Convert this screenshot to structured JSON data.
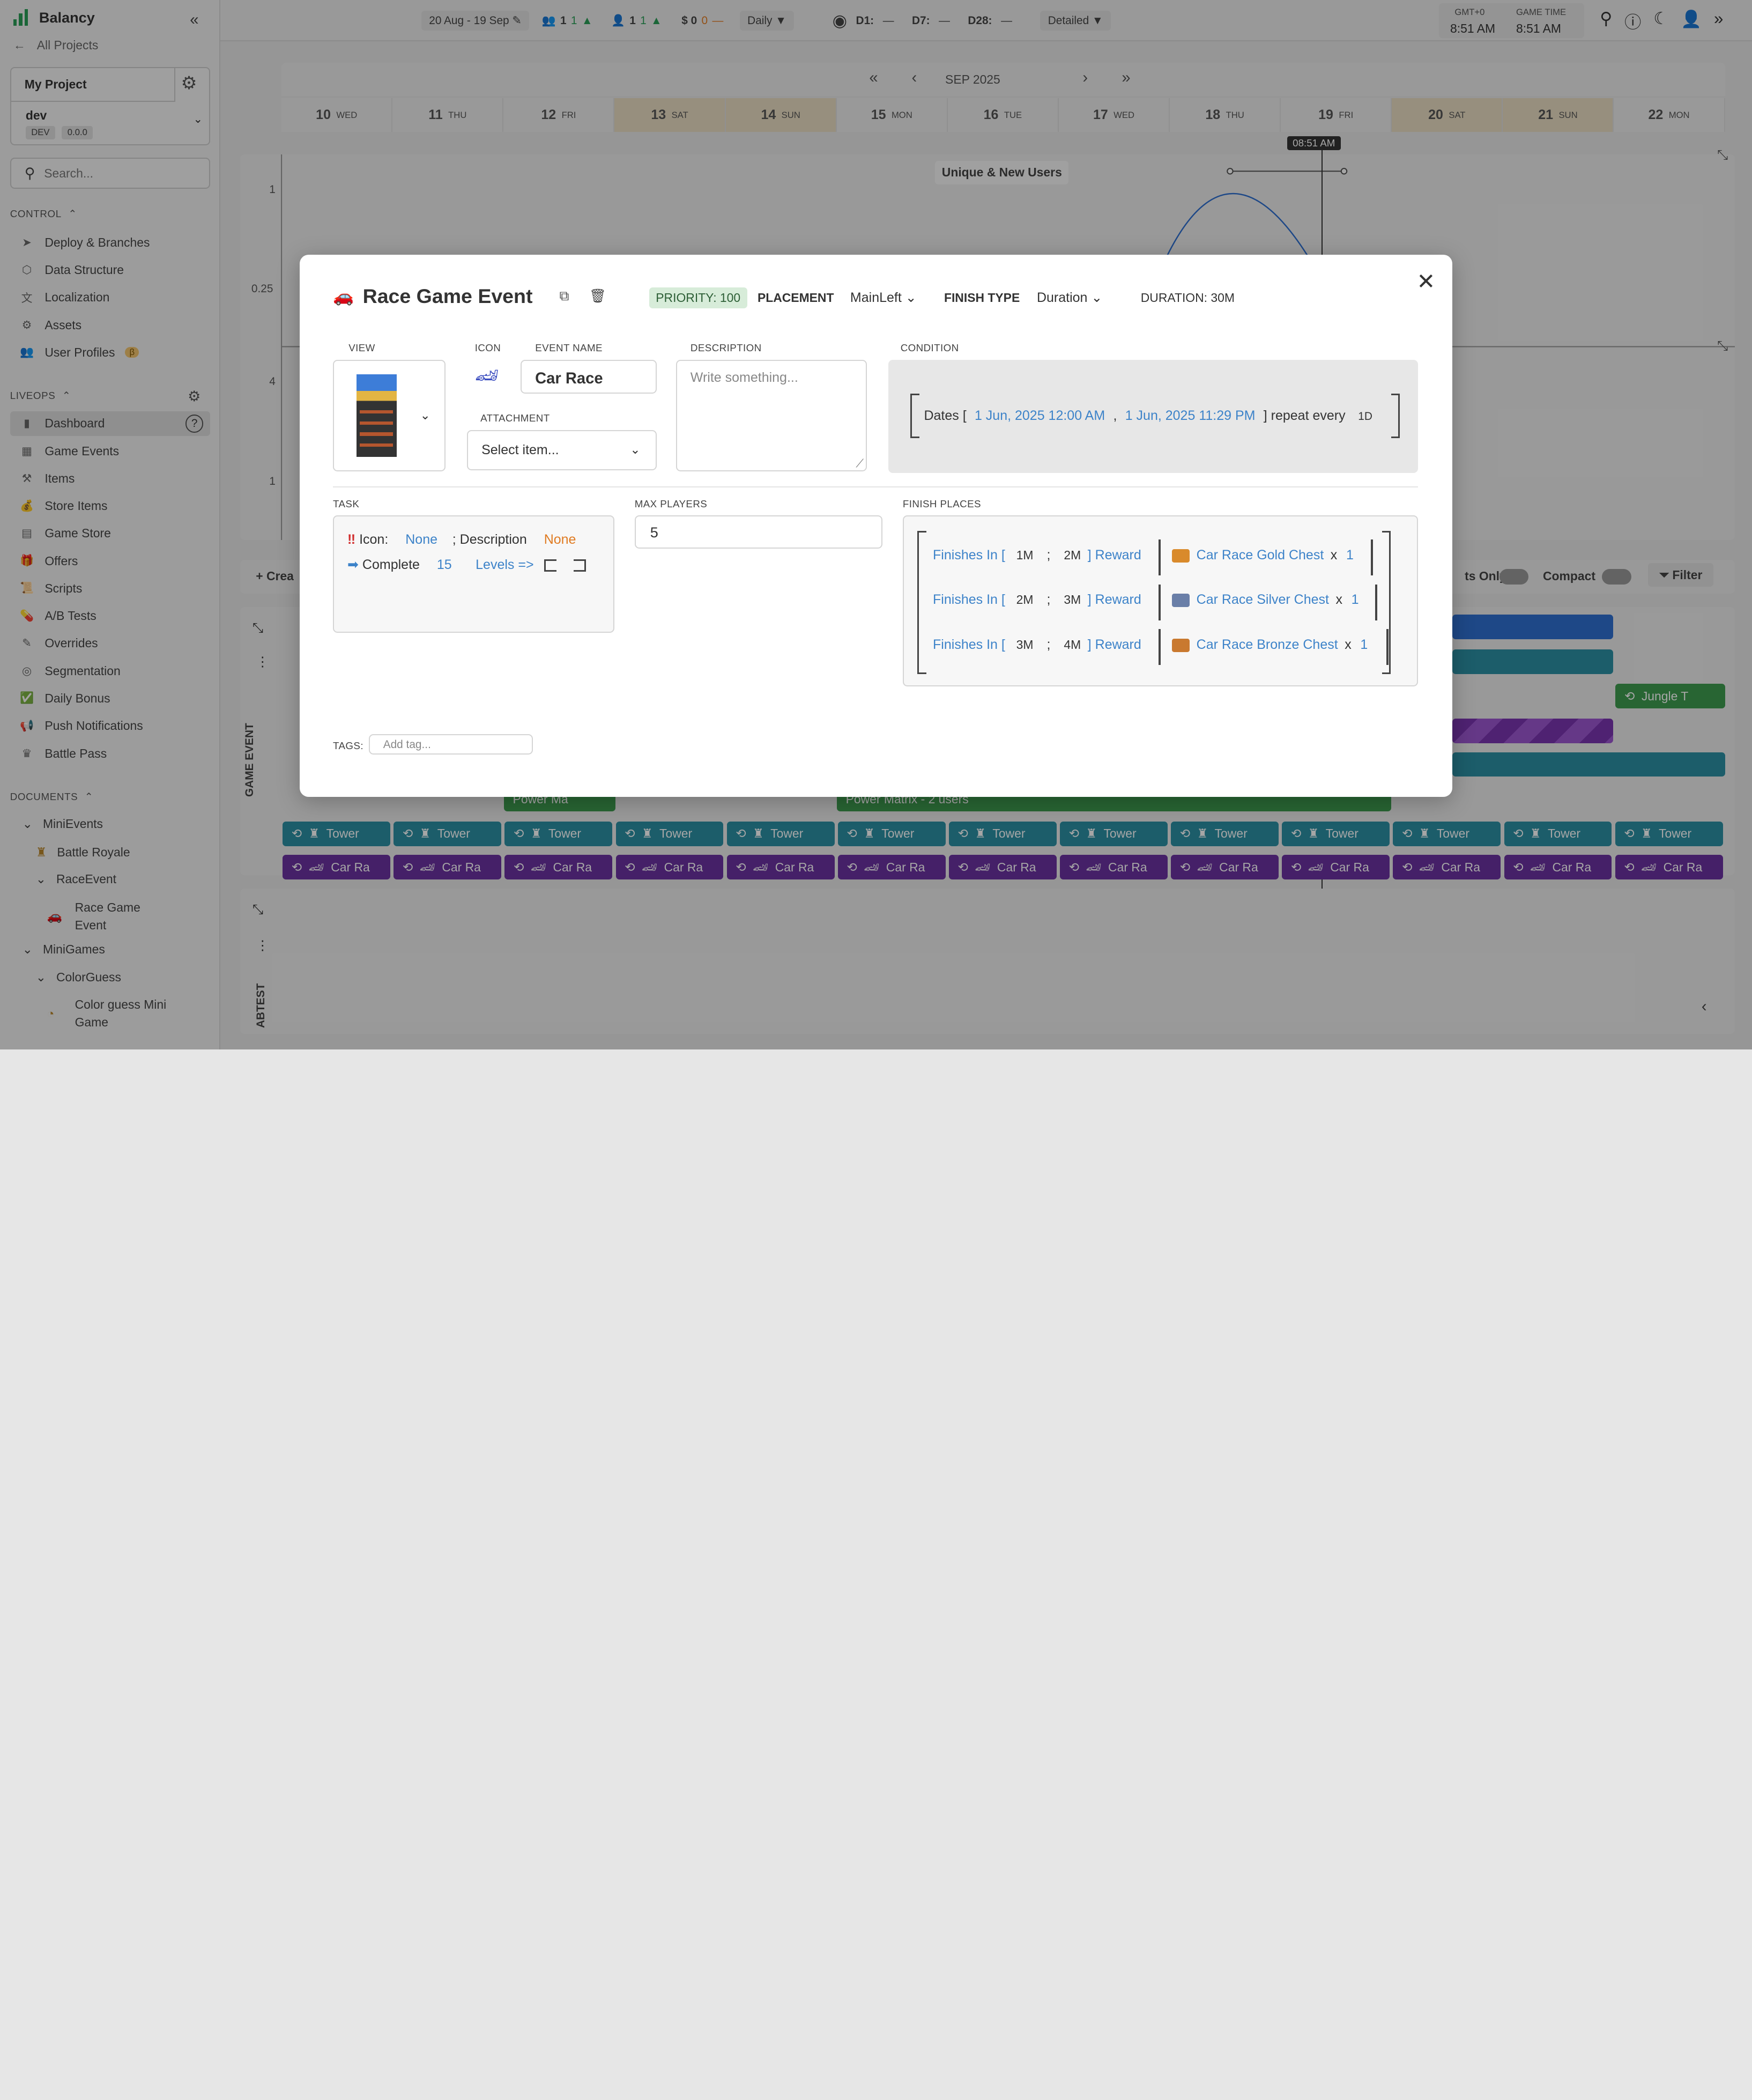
{
  "app": {
    "name": "Balancy",
    "all_projects": "All Projects"
  },
  "project": {
    "name": "My Project",
    "branch": "dev",
    "env": "DEV",
    "version": "0.0.0"
  },
  "search": {
    "placeholder": "Search..."
  },
  "sections": {
    "control": "CONTROL",
    "liveops": "LIVEOPS",
    "documents": "DOCUMENTS"
  },
  "control_items": [
    "Deploy & Branches",
    "Data Structure",
    "Localization",
    "Assets",
    "User Profiles"
  ],
  "user_profiles_badge": "β",
  "liveops_items": [
    "Dashboard",
    "Game Events",
    "Items",
    "Store Items",
    "Game Store",
    "Offers",
    "Scripts",
    "A/B Tests",
    "Overrides",
    "Segmentation",
    "Daily Bonus",
    "Push Notifications",
    "Battle Pass"
  ],
  "documents": {
    "minievents": "MiniEvents",
    "battle_royale": "Battle Royale",
    "raceevent": "RaceEvent",
    "race_game_event_1": "Race Game",
    "race_game_event_2": "Event",
    "minigames": "MiniGames",
    "colorguess": "ColorGuess",
    "color_guess_1": "Color guess Mini",
    "color_guess_2": "Game"
  },
  "topbar": {
    "date_range": "20 Aug - 19 Sep",
    "users_a": "1",
    "users_a_delta": "1",
    "users_b": "1",
    "users_b_delta": "1",
    "revenue": "$ 0",
    "revenue_delta": "0",
    "revenue_dash": "—",
    "period": "Daily",
    "d1": "D1:",
    "d1_val": "—",
    "d7": "D7:",
    "d7_val": "—",
    "d28": "D28:",
    "d28_val": "—",
    "mode": "Detailed",
    "tz_label": "GMT+0",
    "tz_time": "8:51 AM",
    "game_time_label": "GAME TIME",
    "game_time": "8:51 AM"
  },
  "calendar": {
    "month": "SEP 2025",
    "days": [
      {
        "n": "10",
        "d": "WED"
      },
      {
        "n": "11",
        "d": "THU"
      },
      {
        "n": "12",
        "d": "FRI"
      },
      {
        "n": "13",
        "d": "SAT"
      },
      {
        "n": "14",
        "d": "SUN"
      },
      {
        "n": "15",
        "d": "MON"
      },
      {
        "n": "16",
        "d": "TUE"
      },
      {
        "n": "17",
        "d": "WED"
      },
      {
        "n": "18",
        "d": "THU"
      },
      {
        "n": "19",
        "d": "FRI"
      },
      {
        "n": "20",
        "d": "SAT"
      },
      {
        "n": "21",
        "d": "SUN"
      },
      {
        "n": "22",
        "d": "MON"
      }
    ],
    "now_label": "08:51 AM",
    "chart_title": "Unique & New Users",
    "y_ticks": [
      "1",
      "0.25",
      "4",
      "1"
    ]
  },
  "timeline": {
    "create": "+ Crea",
    "events_only": "ts Only",
    "compact": "Compact",
    "filter": "Filter",
    "lane_game_event": "GAME EVENT",
    "lane_abtest": "ABTEST",
    "jungle": "Jungle T",
    "power_ma": "Power Ma",
    "power_matrix": "Power Matrix - 2 users",
    "tower": "Tower",
    "car": "Car Ra"
  },
  "modal": {
    "title": "Race Game Event",
    "priority": "PRIORITY: 100",
    "placement_label": "PLACEMENT",
    "placement_value": "MainLeft",
    "finish_type_label": "FINISH TYPE",
    "finish_type_value": "Duration",
    "duration": "DURATION: 30M",
    "view_label": "VIEW",
    "icon_label": "ICON",
    "event_name_label": "EVENT NAME",
    "event_name": "Car Race",
    "attachment_label": "ATTACHMENT",
    "attachment_value": "Select item...",
    "description_label": "DESCRIPTION",
    "description_placeholder": "Write something...",
    "condition_label": "CONDITION",
    "condition": {
      "dates": "Dates [",
      "from": "1 Jun, 2025 12:00 AM",
      "sep": ",",
      "to": "1 Jun, 2025 11:29 PM",
      "repeat": "] repeat every",
      "interval": "1D"
    },
    "task_label": "TASK",
    "task": {
      "icon_label": "Icon:",
      "icon_value": "None",
      "desc_label": "; Description",
      "desc_value": "None",
      "complete": "Complete",
      "count": "15",
      "levels": "Levels =>"
    },
    "max_players_label": "MAX PLAYERS",
    "max_players": "5",
    "finish_places_label": "FINISH PLACES",
    "finish_places": [
      {
        "from": "1M",
        "to": "2M",
        "reward": "Car Race Gold Chest",
        "count": "1",
        "color": "#d98a2b"
      },
      {
        "from": "2M",
        "to": "3M",
        "reward": "Car Race Silver Chest",
        "count": "1",
        "color": "#6a7fa8"
      },
      {
        "from": "3M",
        "to": "4M",
        "reward": "Car Race Bronze Chest",
        "count": "1",
        "color": "#c9792f"
      }
    ],
    "finishes_in": "Finishes In [",
    "semicolon": ";",
    "reward_label": "] Reward",
    "x": "x",
    "tags_label": "TAGS:",
    "tags_placeholder": "Add tag..."
  }
}
